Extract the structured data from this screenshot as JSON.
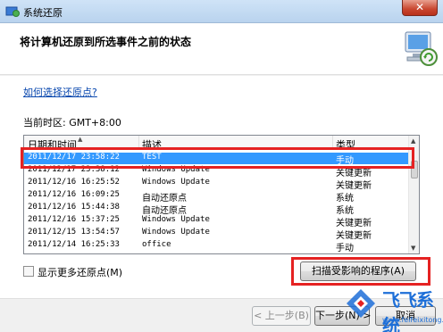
{
  "window": {
    "title": "系统还原",
    "close_glyph": "✕"
  },
  "header": {
    "title": "将计算机还原到所选事件之前的状态"
  },
  "help_link": "如何选择还原点?",
  "timezone": "当前时区: GMT+8:00",
  "list": {
    "columns": [
      "日期和时间",
      "描述",
      "类型"
    ],
    "rows": [
      {
        "datetime": "2011/12/17 23:58:22",
        "desc": "TEST",
        "type": "手动",
        "selected": true
      },
      {
        "datetime": "2011/12/17 23:38:12",
        "desc": "Windows Update",
        "type": "关键更新"
      },
      {
        "datetime": "2011/12/16 16:25:52",
        "desc": "Windows Update",
        "type": "关键更新"
      },
      {
        "datetime": "2011/12/16 16:09:25",
        "desc": "自动还原点",
        "type": "系统"
      },
      {
        "datetime": "2011/12/16 15:44:38",
        "desc": "自动还原点",
        "type": "系统"
      },
      {
        "datetime": "2011/12/16 15:37:25",
        "desc": "Windows Update",
        "type": "关键更新"
      },
      {
        "datetime": "2011/12/15 13:54:57",
        "desc": "Windows Update",
        "type": "关键更新"
      },
      {
        "datetime": "2011/12/14 16:25:33",
        "desc": "office",
        "type": "手动"
      }
    ]
  },
  "show_more_label": "显示更多还原点(M)",
  "scan_button": "扫描受影响的程序(A)",
  "buttons": {
    "back": "< 上一步(B)",
    "next": "下一步(N) >",
    "cancel": "取消"
  },
  "watermark": {
    "text": "飞飞系统",
    "url": "www.feifeixitong.com"
  },
  "colors": {
    "selection": "#3399ff",
    "highlight_box": "#e52222",
    "link": "#0645ad"
  }
}
